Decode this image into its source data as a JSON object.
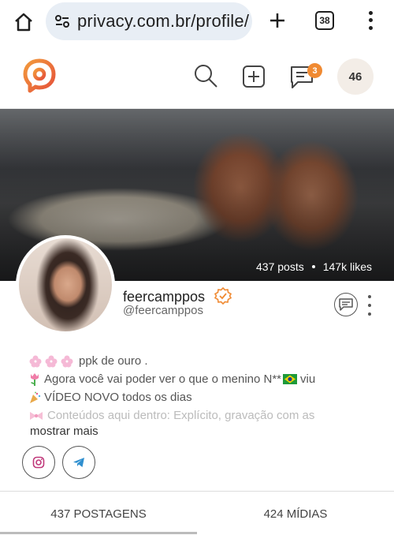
{
  "browser": {
    "url": "privacy.com.br/profile/",
    "tab_count": "38"
  },
  "header": {
    "chat_badge": "3",
    "avatar_initials": "46"
  },
  "cover": {
    "posts": "437 posts",
    "likes": "147k likes"
  },
  "profile": {
    "name": "feercamppos",
    "handle": "@feercamppos"
  },
  "bio": {
    "lines": [
      "ppk de ouro .",
      "Agora você vai poder ver o que o menino N** ",
      "VÍDEO NOVO todos os dias",
      "Conteúdos aqui dentro: Explícito, gravação com as"
    ],
    "line2_suffix": "viu",
    "show_more": "mostrar mais"
  },
  "tabs": [
    {
      "label": "437 POSTAGENS"
    },
    {
      "label": "424 MÍDIAS"
    }
  ],
  "colors": {
    "accent": "#f08a32",
    "logo": "#ef6a3a"
  }
}
